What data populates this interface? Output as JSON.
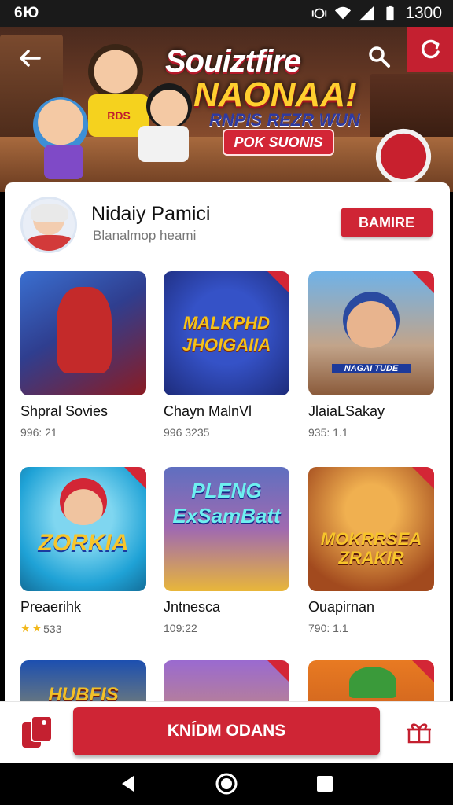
{
  "status_bar": {
    "carrier": "6Ю",
    "time": "1300"
  },
  "banner": {
    "title_line1": "Souiztfire",
    "title_line2": "NAONAA!",
    "subtitle": "RNPIS REZR WUN",
    "pill_label": "POK SUONIS",
    "character_badge": "RDS"
  },
  "profile": {
    "name": "Nidaiy Pamici",
    "subtitle": "Blanalmop heami",
    "action_label": "BAMIRE"
  },
  "games": [
    {
      "title": "Shpral Sovies",
      "meta": "996: 21",
      "thumb_text": "",
      "colors": [
        "#8b1b22",
        "#3a6fd0"
      ]
    },
    {
      "title": "Chayn MalnVl",
      "meta": "996 3235",
      "thumb_text": "MALKPHD JHOIGAIIA",
      "colors": [
        "#1d2b7a",
        "#f5b416"
      ]
    },
    {
      "title": "JlaiaLSakay",
      "meta": "935: 1.1",
      "thumb_text": "NAGAI TUDE",
      "colors": [
        "#5b9ad6",
        "#c45b2a"
      ]
    },
    {
      "title": "Preaerihk",
      "meta": "533",
      "stars": 2,
      "thumb_text": "ZORKIA",
      "colors": [
        "#1fa2d6",
        "#f2c230"
      ]
    },
    {
      "title": "Jntnesca",
      "meta": "109:22",
      "thumb_text": "PLENG ExSamBatt",
      "colors": [
        "#7a5a9e",
        "#e8b63a"
      ]
    },
    {
      "title": "Ouapirnan",
      "meta": "790: 1.1",
      "thumb_text": "MOKRRSEA ZRAKIR",
      "colors": [
        "#a24a1e",
        "#f0a030"
      ]
    },
    {
      "title": "",
      "meta": "",
      "thumb_text": "HUBFIS",
      "colors": [
        "#1c4fb0",
        "#f2c028"
      ]
    },
    {
      "title": "",
      "meta": "",
      "thumb_text": "",
      "colors": [
        "#9a6ad0",
        "#e6a33a"
      ]
    },
    {
      "title": "",
      "meta": "",
      "thumb_text": "",
      "colors": [
        "#e87a22",
        "#3a9a3a"
      ]
    }
  ],
  "action_bar": {
    "primary_label": "KNÍDM ODANS"
  },
  "colors": {
    "accent": "#cf2535",
    "banner_bg": "#6b3b25"
  },
  "icons": [
    "back-arrow-icon",
    "search-icon",
    "refresh-icon",
    "cards-icon",
    "gift-icon",
    "nav-back-icon",
    "nav-home-icon",
    "nav-recents-icon"
  ]
}
